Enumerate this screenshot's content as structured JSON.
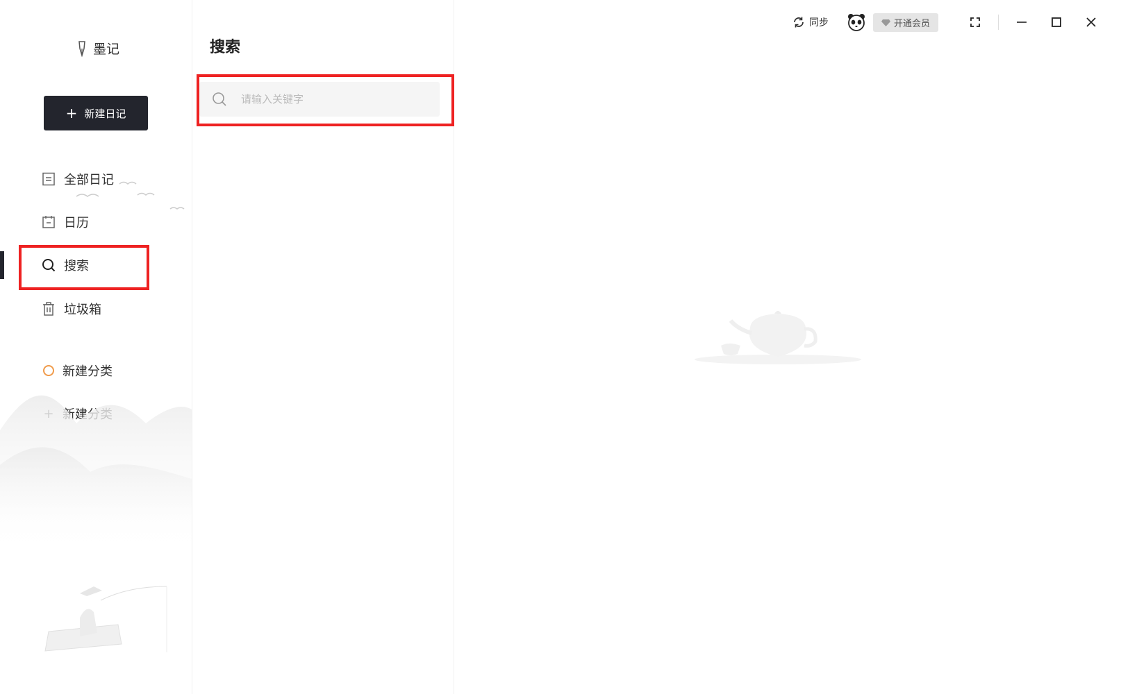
{
  "brand": {
    "name": "墨记"
  },
  "sidebar": {
    "new_button": "新建日记",
    "items": [
      {
        "label": "全部日记"
      },
      {
        "label": "日历"
      },
      {
        "label": "搜索"
      },
      {
        "label": "垃圾箱"
      }
    ],
    "categories": [
      {
        "label": "新建分类"
      },
      {
        "label": "新建分类"
      }
    ]
  },
  "middle": {
    "title": "搜索",
    "search_placeholder": "请输入关键字"
  },
  "topbar": {
    "sync_label": "同步",
    "vip_label": "开通会员"
  },
  "colors": {
    "accent": "#23252d",
    "highlight": "#ee2222",
    "category_dot": "#f09a4a"
  }
}
